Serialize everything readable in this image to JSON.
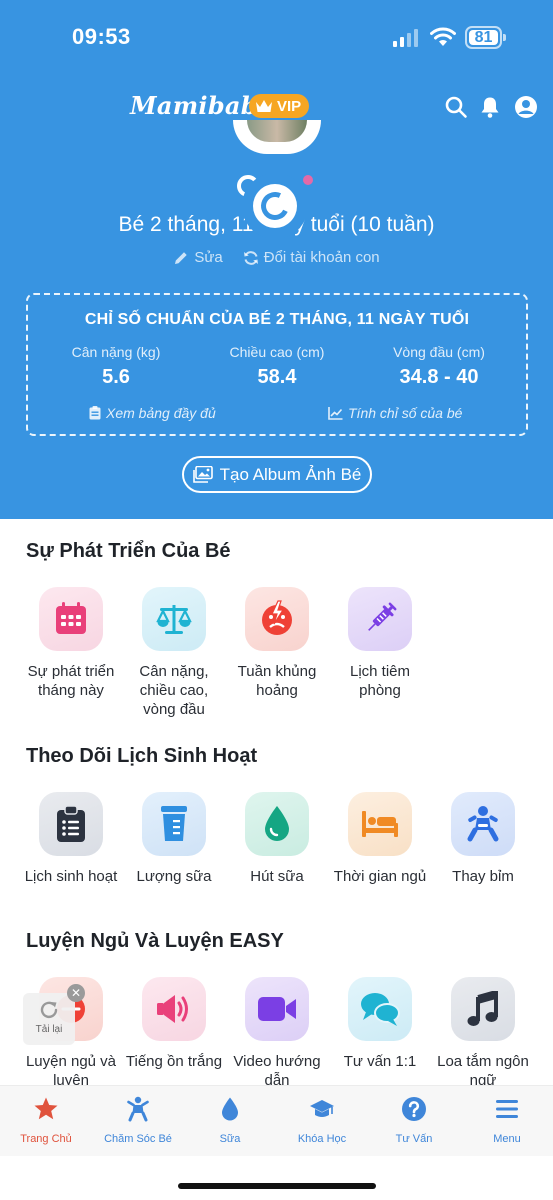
{
  "status_bar": {
    "time": "09:53",
    "battery": "81"
  },
  "app": {
    "logo": "Mamibabi",
    "vip": "VIP"
  },
  "baby": {
    "age": "Bé 2 tháng, 11 ngày tuổi (10 tuần)"
  },
  "profile_actions": {
    "edit": "Sửa",
    "switch": "Đổi tài khoản con"
  },
  "standards": {
    "title": "CHỈ SỐ CHUẨN CỦA BÉ 2 THÁNG, 11 NGÀY TUỔI",
    "metrics": [
      {
        "label": "Cân nặng (kg)",
        "value": "5.6"
      },
      {
        "label": "Chiều cao (cm)",
        "value": "58.4"
      },
      {
        "label": "Vòng đầu (cm)",
        "value": "34.8 - 40"
      }
    ],
    "view_table": "Xem bảng đầy đủ",
    "calculate": "Tính chỉ số của bé"
  },
  "album_button": "Tạo Album Ảnh Bé",
  "sections": [
    {
      "title": "Sự Phát Triển Của Bé",
      "items": [
        {
          "label": "Sự phát triển tháng này",
          "icon": "calendar-icon",
          "color": "#e9407a"
        },
        {
          "label": "Cân nặng, chiều cao, vòng đầu",
          "icon": "scale-icon",
          "color": "#1fb3d2"
        },
        {
          "label": "Tuần khủng hoảng",
          "icon": "crisis-icon",
          "color": "#ef4136"
        },
        {
          "label": "Lịch tiêm phòng",
          "icon": "syringe-icon",
          "color": "#7b3fe4"
        }
      ]
    },
    {
      "title": "Theo Dõi Lịch Sinh Hoạt",
      "items": [
        {
          "label": "Lịch sinh hoạt",
          "icon": "clipboard-icon",
          "color": "#2c3340"
        },
        {
          "label": "Lượng sữa",
          "icon": "cup-icon",
          "color": "#2f8fe0"
        },
        {
          "label": "Hút sữa",
          "icon": "drop-icon",
          "color": "#15a683"
        },
        {
          "label": "Thời gian ngủ",
          "icon": "bed-icon",
          "color": "#f08a24"
        },
        {
          "label": "Thay bỉm",
          "icon": "baby-icon",
          "color": "#2f6fe0"
        }
      ]
    },
    {
      "title": "Luyện Ngủ Và Luyện EASY",
      "items": [
        {
          "label": "Luyện ngủ và luyện",
          "icon": "sleep-train-icon",
          "color": "#ef4136"
        },
        {
          "label": "Tiếng ồn trắng",
          "icon": "speaker-icon",
          "color": "#e9407a"
        },
        {
          "label": "Video hướng dẫn",
          "icon": "video-icon",
          "color": "#7b3fe4"
        },
        {
          "label": "Tư vấn 1:1",
          "icon": "chat-icon",
          "color": "#1fb3d2"
        },
        {
          "label": "Loa tắm ngôn ngữ",
          "icon": "music-icon",
          "color": "#2c3340"
        }
      ]
    }
  ],
  "reload_toast": {
    "label": "Tải lại"
  },
  "tabbar": [
    {
      "label": "Trang Chủ",
      "icon": "star-icon",
      "active": true
    },
    {
      "label": "Chăm Sóc Bé",
      "icon": "baby-care-icon"
    },
    {
      "label": "Sữa",
      "icon": "milk-drop-icon"
    },
    {
      "label": "Khóa Học",
      "icon": "graduation-cap-icon"
    },
    {
      "label": "Tư Vấn",
      "icon": "question-icon"
    },
    {
      "label": "Menu",
      "icon": "menu-icon"
    }
  ]
}
